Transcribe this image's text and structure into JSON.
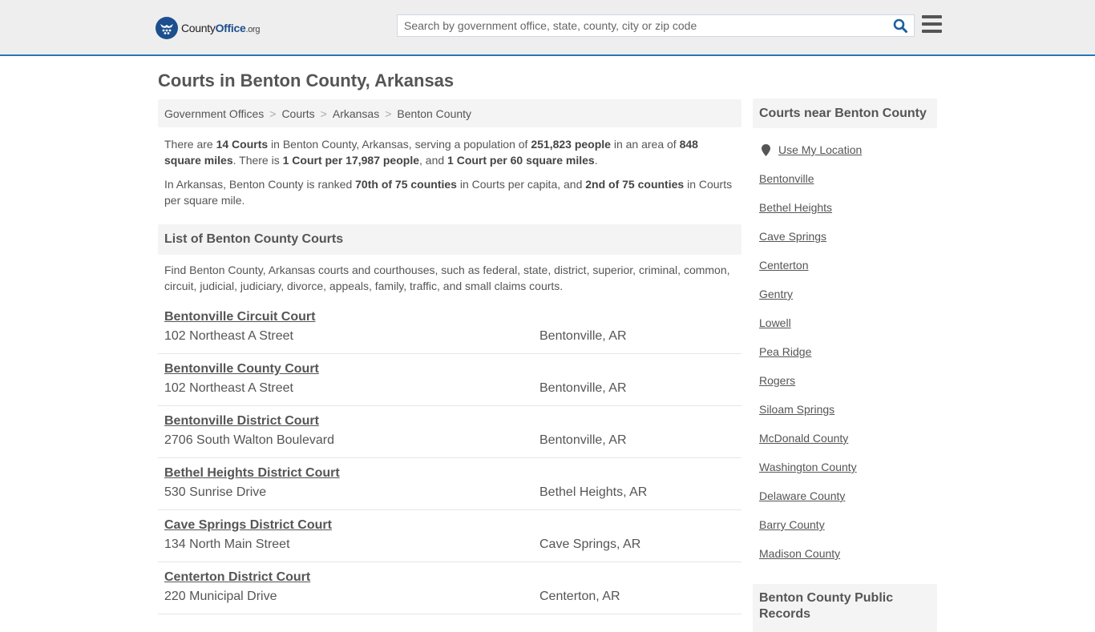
{
  "header": {
    "logo": {
      "county": "County",
      "office": "Office",
      "org": ".org"
    },
    "search": {
      "placeholder": "Search by government office, state, county, city or zip code",
      "value": ""
    },
    "icons": {
      "logo": "eagle-stars-badge-icon",
      "search": "search-icon",
      "menu": "hamburger-menu-icon"
    }
  },
  "page": {
    "title": "Courts in Benton County, Arkansas"
  },
  "breadcrumb": [
    {
      "label": "Government Offices"
    },
    {
      "label": "Courts"
    },
    {
      "label": "Arkansas"
    },
    {
      "label": "Benton County"
    }
  ],
  "breadcrumb_separator": ">",
  "intro": {
    "p1": {
      "t1": "There are ",
      "b1": "14 Courts",
      "t2": " in Benton County, Arkansas, serving a population of ",
      "b2": "251,823 people",
      "t3": " in an area of ",
      "b3": "848 square miles",
      "t4": ". There is ",
      "b4": "1 Court per 17,987 people",
      "t5": ", and ",
      "b5": "1 Court per 60 square miles",
      "t6": "."
    },
    "p2": {
      "t1": "In Arkansas, Benton County is ranked ",
      "b1": "70th of 75 counties",
      "t2": " in Courts per capita, and ",
      "b2": "2nd of 75 counties",
      "t3": " in Courts per square mile."
    }
  },
  "list_section": {
    "title": "List of Benton County Courts",
    "description": "Find Benton County, Arkansas courts and courthouses, such as federal, state, district, superior, criminal, common, circuit, judicial, judiciary, divorce, appeals, family, traffic, and small claims courts."
  },
  "courts": [
    {
      "name": "Bentonville Circuit Court",
      "address": "102 Northeast A Street",
      "city": "Bentonville, AR"
    },
    {
      "name": "Bentonville County Court",
      "address": "102 Northeast A Street",
      "city": "Bentonville, AR"
    },
    {
      "name": "Bentonville District Court",
      "address": "2706 South Walton Boulevard",
      "city": "Bentonville, AR"
    },
    {
      "name": "Bethel Heights District Court",
      "address": "530 Sunrise Drive",
      "city": "Bethel Heights, AR"
    },
    {
      "name": "Cave Springs District Court",
      "address": "134 North Main Street",
      "city": "Cave Springs, AR"
    },
    {
      "name": "Centerton District Court",
      "address": "220 Municipal Drive",
      "city": "Centerton, AR"
    }
  ],
  "sidebar": {
    "nearby_title": "Courts near Benton County",
    "use_location": "Use My Location",
    "location_icon": "map-pin-icon",
    "nearby": [
      "Bentonville",
      "Bethel Heights",
      "Cave Springs",
      "Centerton",
      "Gentry",
      "Lowell",
      "Pea Ridge",
      "Rogers",
      "Siloam Springs",
      "McDonald County",
      "Washington County",
      "Delaware County",
      "Barry County",
      "Madison County"
    ],
    "records_title": "Benton County Public Records"
  },
  "colors": {
    "accent_bar": "#2b74b0",
    "logo_blue": "#1d4f8f",
    "text": "#555555",
    "panel_bg": "#f4f4f4",
    "header_bg": "#eeeeee"
  }
}
